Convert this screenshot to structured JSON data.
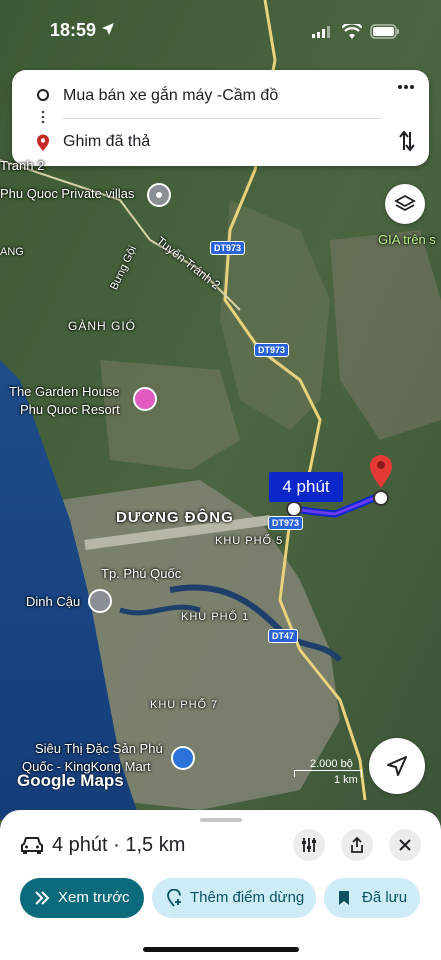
{
  "status_bar": {
    "time": "18:59"
  },
  "search": {
    "origin": "Mua bán xe gắn máy -Cầm đồ",
    "destination": "Ghim đã thả"
  },
  "map": {
    "labels": {
      "tranh2": "Tranh 2",
      "phuquoc_villas": "Phu Quoc Private villas",
      "ang": "ANG",
      "bung_goi": "Bưng Gội",
      "tuyen_tranh_2": "Tuyến Tránh 2",
      "gia_tren": "GIA trên s",
      "ganh_gio": "GÀNH GIÓ",
      "garden_house_1": "The Garden House",
      "garden_house_2": "Phu Quoc Resort",
      "duong_dong": "DƯƠNG ĐÔNG",
      "khu_pho_5": "KHU PHỐ 5",
      "tp_phu_quoc": "Tp. Phú Quốc",
      "dinh_cau": "Dinh Cậu",
      "khu_pho_1": "KHU PHỐ 1",
      "khu_pho_7": "KHU PHỐ 7",
      "sieuthi_1": "Siêu Thị Đặc Sản Phú",
      "sieuthi_2": "Quốc - KingKong Mart",
      "google_maps": "Google Maps"
    },
    "roads": {
      "dt973_a": "DT973",
      "dt973_b": "DT973",
      "dt973_c": "DT973",
      "dt47": "DT47"
    },
    "route_time": "4 phút",
    "scale": {
      "imperial": "2.000 bộ",
      "metric": "1 km"
    },
    "route_color": "#0b26c9"
  },
  "sheet": {
    "summary": "4 phút · 1,5 km",
    "buttons": {
      "preview": "Xem trước",
      "add_stop": "Thêm điểm dừng",
      "saved": "Đã lưu"
    }
  }
}
